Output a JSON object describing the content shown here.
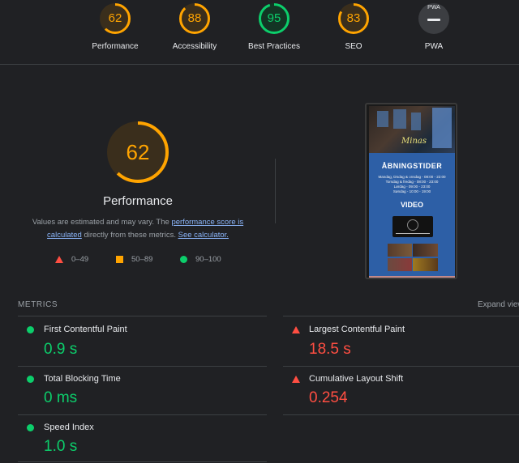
{
  "summary": [
    {
      "score": "62",
      "label": "Performance",
      "color": "#ffa400",
      "fraction": 0.62
    },
    {
      "score": "88",
      "label": "Accessibility",
      "color": "#ffa400",
      "fraction": 0.88
    },
    {
      "score": "95",
      "label": "Best Practices",
      "color": "#0cce6b",
      "fraction": 0.95
    },
    {
      "score": "83",
      "label": "SEO",
      "color": "#ffa400",
      "fraction": 0.83
    },
    {
      "score": "PWA",
      "label": "PWA",
      "color": "#9aa0a6",
      "fraction": 0
    }
  ],
  "performance": {
    "score": "62",
    "fraction": 0.62,
    "title": "Performance",
    "desc_prefix": "Values are estimated and may vary. The ",
    "desc_link1": "performance score is calculated",
    "desc_middle": " directly from these metrics. ",
    "desc_link2": "See calculator."
  },
  "legend": {
    "fail": "0–49",
    "average": "50–89",
    "pass": "90–100"
  },
  "screenshot": {
    "logo": "Minas",
    "heading": "ÅBNINGSTIDER",
    "hours": [
      "Mandag, tirsdag & onsdag - 08:00 - 22:00",
      "Torsdag & fredag - 08:00 - 23:00",
      "Lørdag - 09:00 - 23:00",
      "Søndag - 10:00 - 19:00"
    ],
    "video_heading": "VIDEO"
  },
  "metrics": {
    "title": "METRICS",
    "expand": "Expand view",
    "items": [
      {
        "label": "First Contentful Paint",
        "value": "0.9 s",
        "status": "pass"
      },
      {
        "label": "Largest Contentful Paint",
        "value": "18.5 s",
        "status": "fail"
      },
      {
        "label": "Total Blocking Time",
        "value": "0 ms",
        "status": "pass"
      },
      {
        "label": "Cumulative Layout Shift",
        "value": "0.254",
        "status": "fail"
      },
      {
        "label": "Speed Index",
        "value": "1.0 s",
        "status": "pass"
      }
    ]
  },
  "colors": {
    "pass": "#0cce6b",
    "average": "#ffa400",
    "fail": "#ff4e42",
    "background": "#202124"
  }
}
